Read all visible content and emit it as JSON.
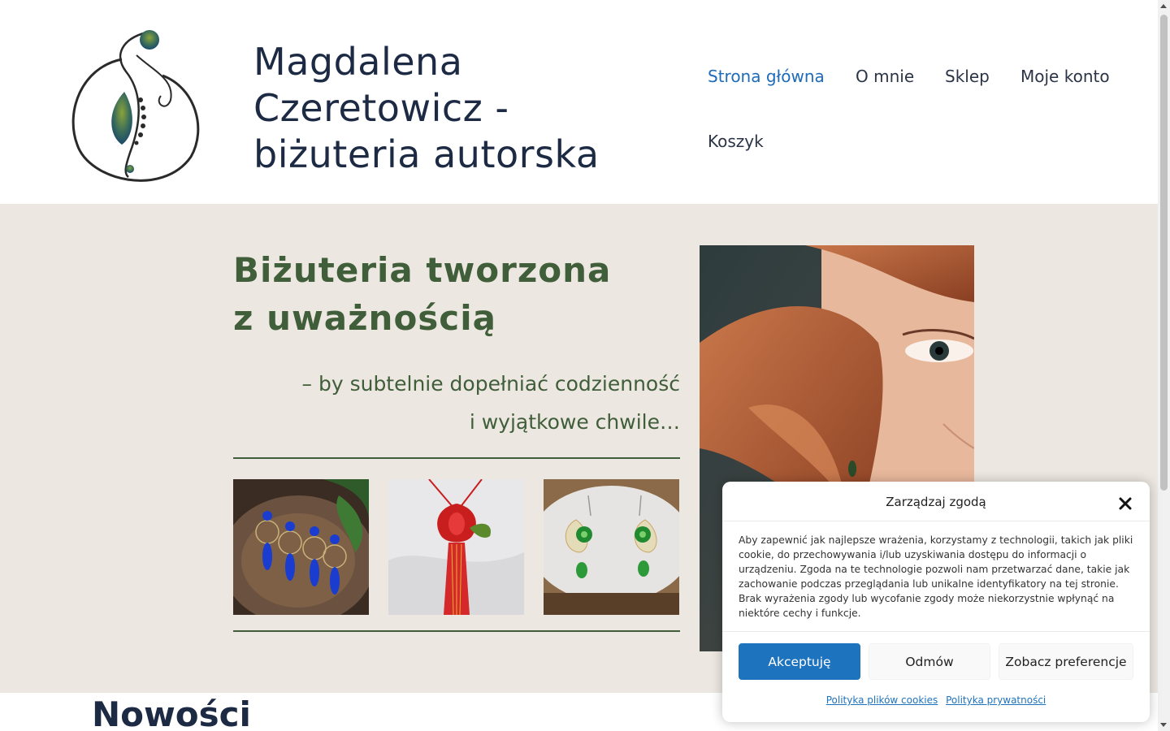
{
  "header": {
    "site_title": "Magdalena Czeretowicz - biżuteria autorska",
    "nav": [
      {
        "label": "Strona główna",
        "active": true
      },
      {
        "label": "O mnie",
        "active": false
      },
      {
        "label": "Sklep",
        "active": false
      },
      {
        "label": "Moje konto",
        "active": false
      },
      {
        "label": "Koszyk",
        "active": false
      }
    ]
  },
  "hero": {
    "title_line1": "Biżuteria tworzona",
    "title_line2": "z uważnością",
    "subtitle_line1": "– by subtelnie dopełniać codzienność",
    "subtitle_line2": "i wyjątkowe chwile…",
    "thumbnails": [
      "blue-earrings-image",
      "red-pendant-image",
      "green-earrings-image"
    ],
    "portrait": "portrait-photo"
  },
  "section": {
    "title": "Nowości"
  },
  "cookie": {
    "title": "Zarządzaj zgodą",
    "text": "Aby zapewnić jak najlepsze wrażenia, korzystamy z technologii, takich jak pliki cookie, do przechowywania i/lub uzyskiwania dostępu do informacji o urządzeniu. Zgoda na te technologie pozwoli nam przetwarzać dane, takie jak zachowanie podczas przeglądania lub unikalne identyfikatory na tej stronie. Brak wyrażenia zgody lub wycofanie zgody może niekorzystnie wpłynąć na niektóre cechy i funkcje.",
    "accept_label": "Akceptuję",
    "deny_label": "Odmów",
    "prefs_label": "Zobacz preferencje",
    "cookie_policy_link": "Polityka plików cookies",
    "privacy_policy_link": "Polityka prywatności"
  },
  "colors": {
    "accent_blue": "#1e73be",
    "hero_green": "#3f5e39",
    "hero_bg": "#ece7e1",
    "title_navy": "#1d2a44"
  }
}
